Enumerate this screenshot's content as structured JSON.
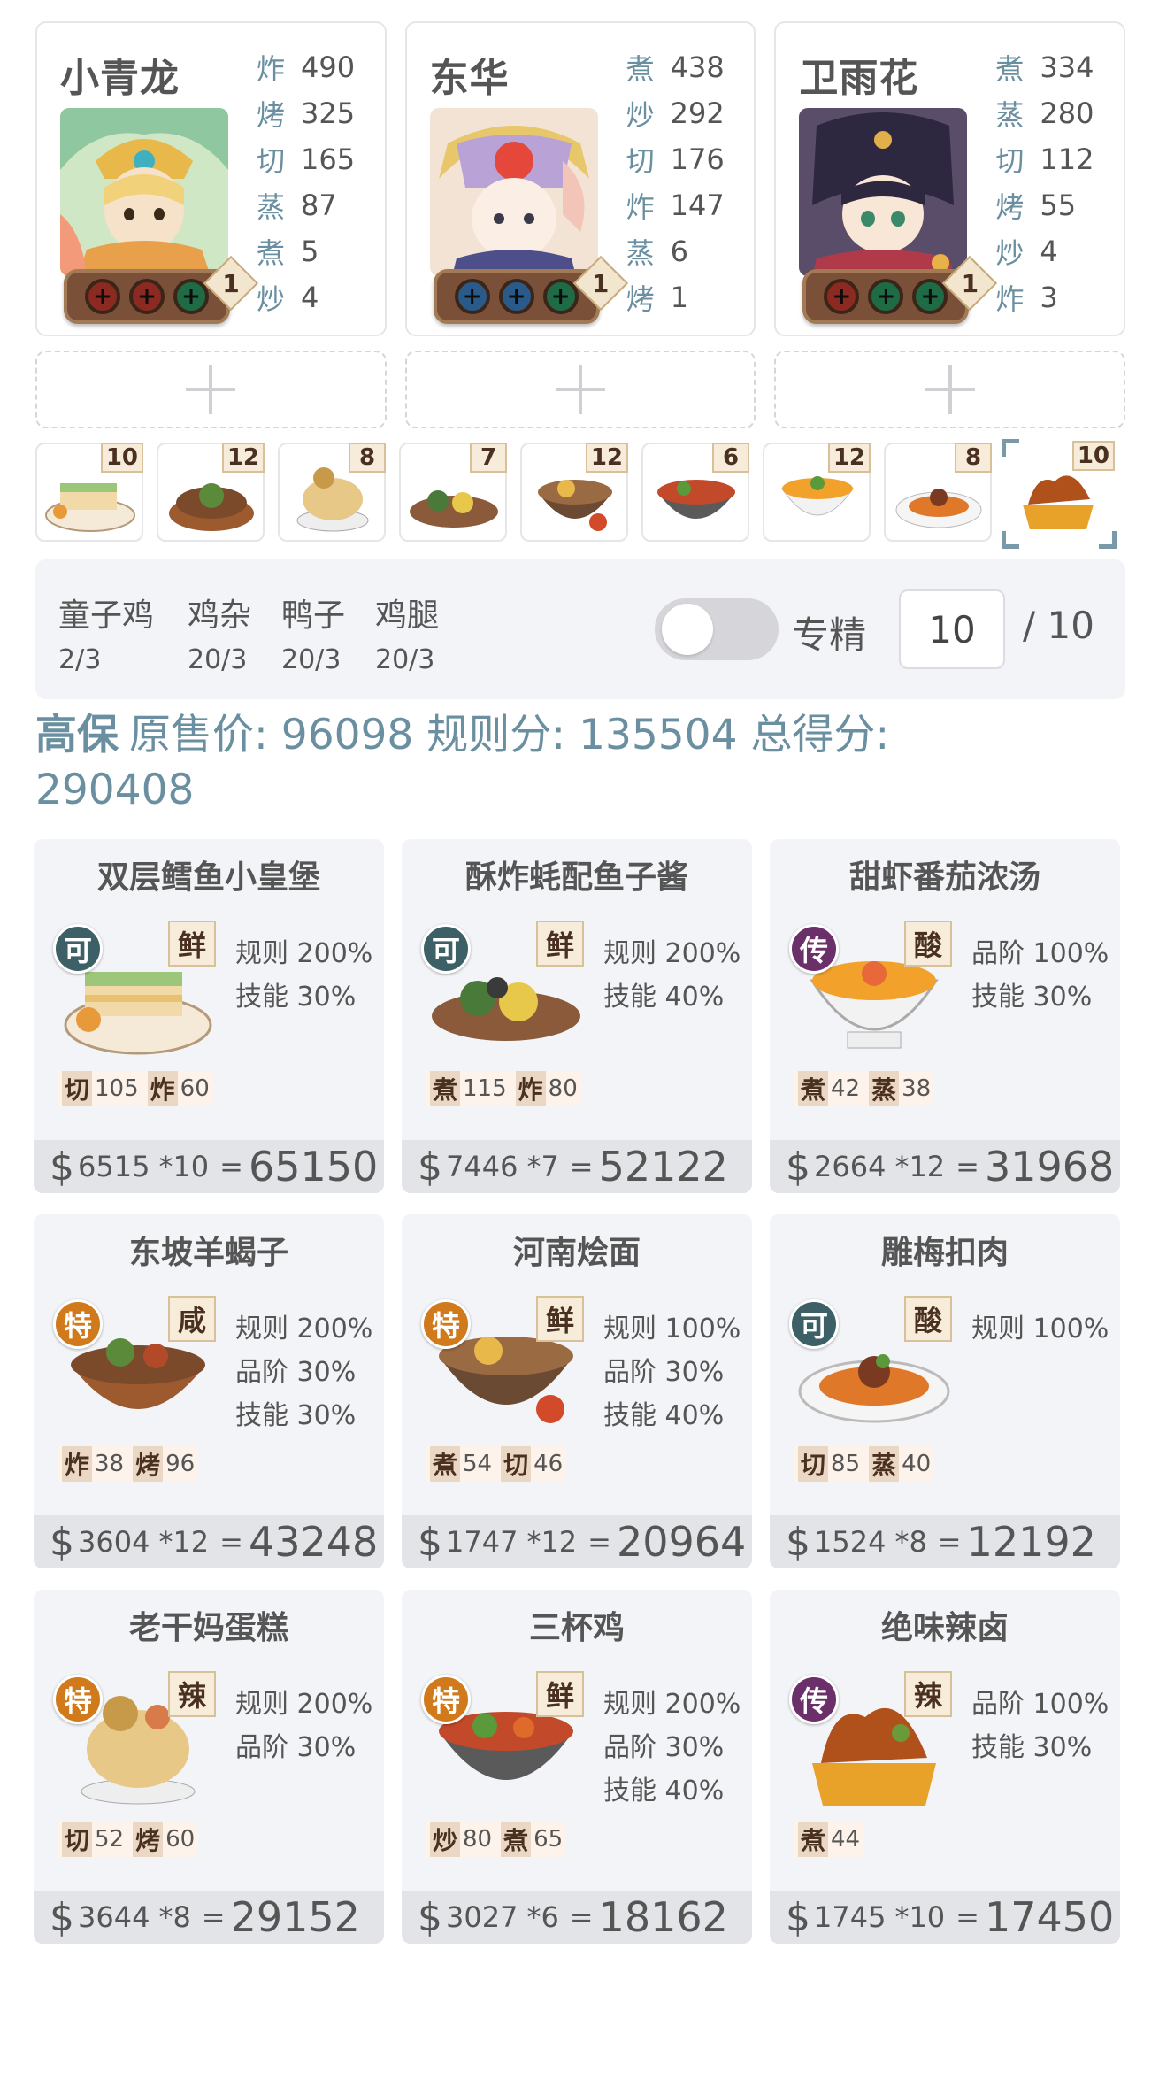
{
  "chefs": [
    {
      "name": "小青龙",
      "level": "1",
      "equip": [
        {
          "color": "red",
          "symbol": "+"
        },
        {
          "color": "red",
          "symbol": "+"
        },
        {
          "color": "green",
          "symbol": "+"
        }
      ],
      "skills": [
        {
          "n": "炸",
          "v": "490"
        },
        {
          "n": "烤",
          "v": "325"
        },
        {
          "n": "切",
          "v": "165"
        },
        {
          "n": "蒸",
          "v": "87"
        },
        {
          "n": "煮",
          "v": "5"
        },
        {
          "n": "炒",
          "v": "4"
        }
      ]
    },
    {
      "name": "东华",
      "level": "1",
      "equip": [
        {
          "color": "blue",
          "symbol": "+"
        },
        {
          "color": "blue",
          "symbol": "+"
        },
        {
          "color": "green",
          "symbol": "+"
        }
      ],
      "skills": [
        {
          "n": "煮",
          "v": "438"
        },
        {
          "n": "炒",
          "v": "292"
        },
        {
          "n": "切",
          "v": "176"
        },
        {
          "n": "炸",
          "v": "147"
        },
        {
          "n": "蒸",
          "v": "6"
        },
        {
          "n": "烤",
          "v": "1"
        }
      ]
    },
    {
      "name": "卫雨花",
      "level": "1",
      "equip": [
        {
          "color": "red",
          "symbol": "+"
        },
        {
          "color": "green",
          "symbol": "+"
        },
        {
          "color": "green",
          "symbol": "+"
        }
      ],
      "skills": [
        {
          "n": "煮",
          "v": "334"
        },
        {
          "n": "蒸",
          "v": "280"
        },
        {
          "n": "切",
          "v": "112"
        },
        {
          "n": "烤",
          "v": "55"
        },
        {
          "n": "炒",
          "v": "4"
        },
        {
          "n": "炸",
          "v": "3"
        }
      ]
    }
  ],
  "thumbnails": [
    "10",
    "12",
    "8",
    "7",
    "12",
    "6",
    "12",
    "8",
    "10"
  ],
  "materials": [
    {
      "name": "童子鸡",
      "count": "2/3"
    },
    {
      "name": "鸡杂",
      "count": "20/3"
    },
    {
      "name": "鸭子",
      "count": "20/3"
    },
    {
      "name": "鸡腿",
      "count": "20/3"
    }
  ],
  "specialize": {
    "label": "专精",
    "value": "10",
    "max": "/ 10"
  },
  "summary": {
    "name": "高保",
    "original_price_label": "原售价:",
    "original_price": "96098",
    "rule_score_label": "规则分:",
    "rule_score": "135504",
    "total_label": "总得分:",
    "total": "290408"
  },
  "recipes": [
    {
      "name": "双层鳕鱼小皇堡",
      "rarity": "可",
      "rarity_class": "ke",
      "flavor": "鲜",
      "bonuses": [
        "规则 200%",
        "技能 30%"
      ],
      "reqs": [
        {
          "s": "切",
          "v": "105"
        },
        {
          "s": "炸",
          "v": "60"
        }
      ],
      "price": "6515",
      "mult": "*10",
      "total": "65150"
    },
    {
      "name": "酥炸蚝配鱼子酱",
      "rarity": "可",
      "rarity_class": "ke",
      "flavor": "鲜",
      "bonuses": [
        "规则 200%",
        "技能 40%"
      ],
      "reqs": [
        {
          "s": "煮",
          "v": "115"
        },
        {
          "s": "炸",
          "v": "80"
        }
      ],
      "price": "7446",
      "mult": "*7",
      "total": "52122"
    },
    {
      "name": "甜虾番茄浓汤",
      "rarity": "传",
      "rarity_class": "chuan",
      "flavor": "酸",
      "bonuses": [
        "品阶 100%",
        "技能 30%"
      ],
      "reqs": [
        {
          "s": "煮",
          "v": "42"
        },
        {
          "s": "蒸",
          "v": "38"
        }
      ],
      "price": "2664",
      "mult": "*12",
      "total": "31968"
    },
    {
      "name": "东坡羊蝎子",
      "rarity": "特",
      "rarity_class": "te",
      "flavor": "咸",
      "bonuses": [
        "规则 200%",
        "品阶 30%",
        "技能 30%"
      ],
      "reqs": [
        {
          "s": "炸",
          "v": "38"
        },
        {
          "s": "烤",
          "v": "96"
        }
      ],
      "price": "3604",
      "mult": "*12",
      "total": "43248"
    },
    {
      "name": "河南烩面",
      "rarity": "特",
      "rarity_class": "te",
      "flavor": "鲜",
      "bonuses": [
        "规则 100%",
        "品阶 30%",
        "技能 40%"
      ],
      "reqs": [
        {
          "s": "煮",
          "v": "54"
        },
        {
          "s": "切",
          "v": "46"
        }
      ],
      "price": "1747",
      "mult": "*12",
      "total": "20964"
    },
    {
      "name": "雕梅扣肉",
      "rarity": "可",
      "rarity_class": "ke",
      "flavor": "酸",
      "bonuses": [
        "规则 100%"
      ],
      "reqs": [
        {
          "s": "切",
          "v": "85"
        },
        {
          "s": "蒸",
          "v": "40"
        }
      ],
      "price": "1524",
      "mult": "*8",
      "total": "12192"
    },
    {
      "name": "老干妈蛋糕",
      "rarity": "特",
      "rarity_class": "te",
      "flavor": "辣",
      "bonuses": [
        "规则 200%",
        "品阶 30%"
      ],
      "reqs": [
        {
          "s": "切",
          "v": "52"
        },
        {
          "s": "烤",
          "v": "60"
        }
      ],
      "price": "3644",
      "mult": "*8",
      "total": "29152"
    },
    {
      "name": "三杯鸡",
      "rarity": "特",
      "rarity_class": "te",
      "flavor": "鲜",
      "bonuses": [
        "规则 200%",
        "品阶 30%",
        "技能 40%"
      ],
      "reqs": [
        {
          "s": "炒",
          "v": "80"
        },
        {
          "s": "煮",
          "v": "65"
        }
      ],
      "price": "3027",
      "mult": "*6",
      "total": "18162"
    },
    {
      "name": "绝味辣卤",
      "rarity": "传",
      "rarity_class": "chuan",
      "flavor": "辣",
      "bonuses": [
        "品阶 100%",
        "技能 30%"
      ],
      "reqs": [
        {
          "s": "煮",
          "v": "44"
        }
      ],
      "price": "1745",
      "mult": "*10",
      "total": "17450"
    }
  ],
  "colors": {
    "accent": "#6a8fa0",
    "card_bg": "#f3f4f8",
    "footer_bg": "#e3e4e8",
    "flavor_bg": "#f6ecd9",
    "ke": "#3d5f66",
    "chuan": "#6b2f6a",
    "te": "#d07a1c"
  }
}
